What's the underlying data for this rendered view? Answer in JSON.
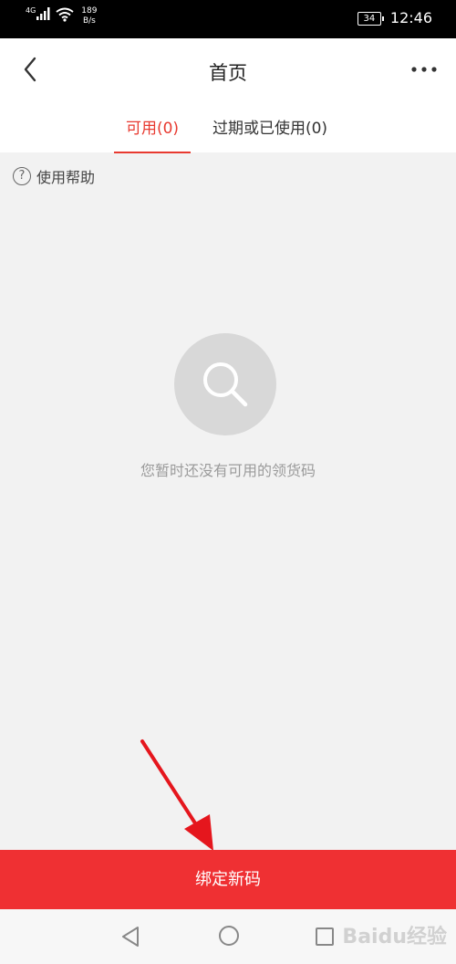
{
  "status_bar": {
    "network": "4G",
    "speed_value": "189",
    "speed_unit": "B/s",
    "battery": "34",
    "time": "12:46"
  },
  "header": {
    "title": "首页",
    "back_icon": "chevron-left-icon",
    "more_icon": "more-horizontal-icon"
  },
  "tabs": [
    {
      "label": "可用(0)",
      "active": true
    },
    {
      "label": "过期或已使用(0)",
      "active": false
    }
  ],
  "help": {
    "label": "使用帮助",
    "icon_glyph": "?"
  },
  "empty_state": {
    "icon": "search-icon",
    "message": "您暂时还没有可用的领货码"
  },
  "bind_button": {
    "label": "绑定新码"
  },
  "nav_bar": {
    "back_icon": "triangle-back-icon",
    "home_icon": "circle-home-icon",
    "recent_icon": "square-recent-icon"
  },
  "watermark": "Baidu经验",
  "colors": {
    "accent": "#e83a30",
    "button": "#ef3033",
    "background": "#f2f2f2"
  }
}
